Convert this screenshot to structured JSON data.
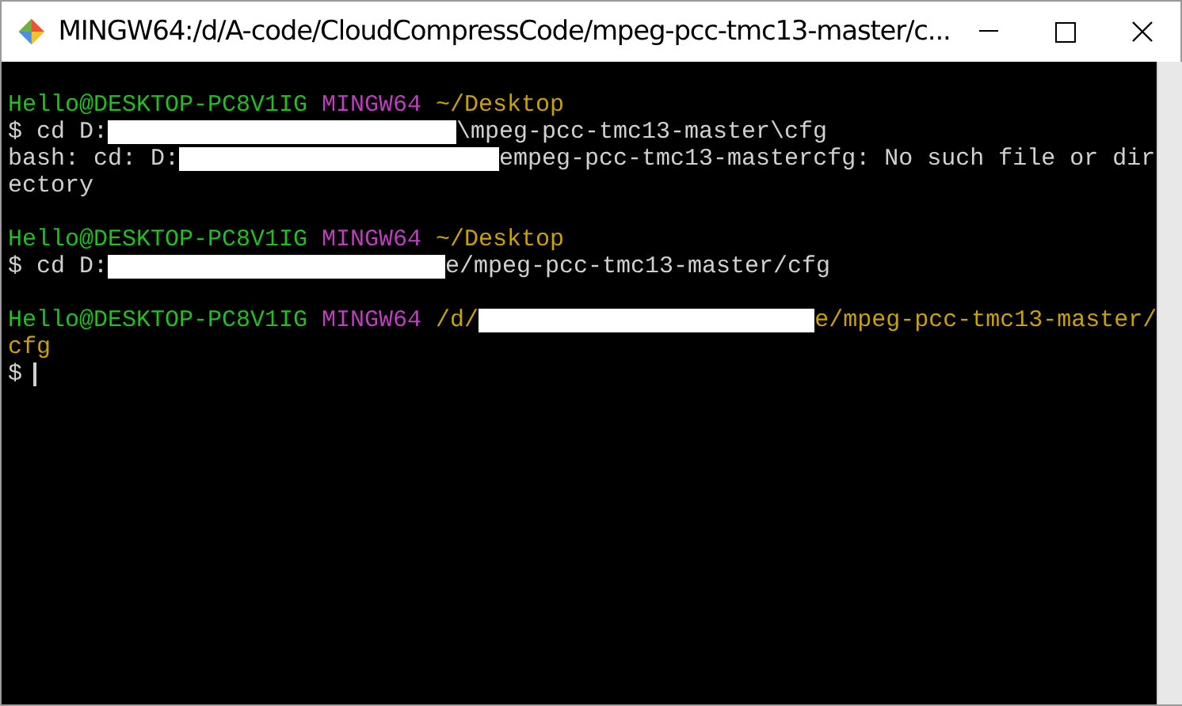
{
  "window": {
    "title": "MINGW64:/d/A-code/CloudCompressCode/mpeg-pcc-tmc13-master/c..."
  },
  "terminal": {
    "blocks": [
      {
        "lines": [
          {
            "segments": [
              {
                "kind": "user",
                "text": "Hello@DESKTOP-PC8V1IG"
              },
              {
                "kind": "system",
                "text": "MINGW64"
              },
              {
                "kind": "path",
                "text": "~/Desktop"
              }
            ]
          },
          {
            "segments": [
              {
                "kind": "plain",
                "text": "$ cd D:"
              },
              {
                "kind": "redaction"
              },
              {
                "kind": "plain",
                "text": "\\mpeg-pcc-tmc13-master\\cfg"
              }
            ]
          },
          {
            "segments": [
              {
                "kind": "plain",
                "text": "bash: cd: D:"
              },
              {
                "kind": "redaction"
              },
              {
                "kind": "plain",
                "text": "empeg-pcc-tmc13-mastercfg: No such file or dir"
              }
            ]
          },
          {
            "segments": [
              {
                "kind": "plain",
                "text": "ectory"
              }
            ]
          }
        ]
      },
      {
        "lines": [
          {
            "segments": [
              {
                "kind": "user",
                "text": "Hello@DESKTOP-PC8V1IG"
              },
              {
                "kind": "system",
                "text": "MINGW64"
              },
              {
                "kind": "path",
                "text": "~/Desktop"
              }
            ]
          },
          {
            "segments": [
              {
                "kind": "plain",
                "text": "$ cd D:"
              },
              {
                "kind": "redaction"
              },
              {
                "kind": "plain",
                "text": "e/mpeg-pcc-tmc13-master/cfg"
              }
            ]
          }
        ]
      },
      {
        "lines": [
          {
            "segments": [
              {
                "kind": "user",
                "text": "Hello@DESKTOP-PC8V1IG"
              },
              {
                "kind": "system",
                "text": "MINGW64"
              },
              {
                "kind": "path",
                "text": "/d/"
              },
              {
                "kind": "redaction"
              },
              {
                "kind": "path",
                "text": "e/mpeg-pcc-tmc13-master/"
              }
            ]
          },
          {
            "segments": [
              {
                "kind": "path",
                "text": "cfg"
              }
            ]
          },
          {
            "segments": [
              {
                "kind": "plain",
                "text": "$"
              },
              {
                "kind": "cursor"
              }
            ]
          }
        ]
      }
    ]
  }
}
